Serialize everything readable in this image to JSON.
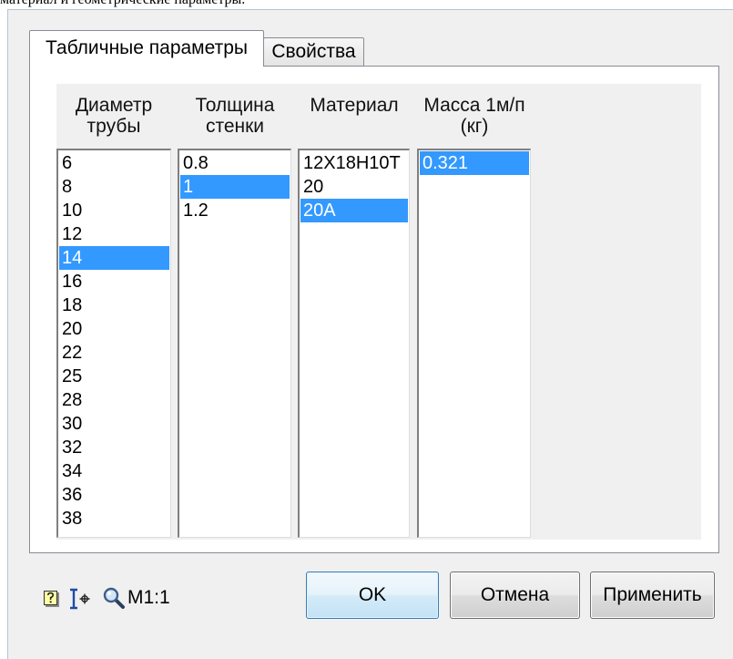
{
  "caption": "материал и геометрические параметры.",
  "tabs": [
    {
      "label": "Табличные параметры",
      "selected": true
    },
    {
      "label": "Свойства",
      "selected": false
    }
  ],
  "columns": [
    {
      "header": [
        "Диаметр",
        "трубы"
      ],
      "items": [
        "6",
        "8",
        "10",
        "12",
        "14",
        "16",
        "18",
        "20",
        "22",
        "25",
        "28",
        "30",
        "32",
        "34",
        "36",
        "38"
      ],
      "selected_index": 4
    },
    {
      "header": [
        "Толщина",
        "стенки"
      ],
      "items": [
        "0.8",
        "1",
        "1.2"
      ],
      "selected_index": 1
    },
    {
      "header": [
        "Материал"
      ],
      "items": [
        "12Х18Н10Т",
        "20",
        "20А"
      ],
      "selected_index": 2
    },
    {
      "header": [
        "Масса 1м/п",
        "(кг)"
      ],
      "items": [
        "0.321"
      ],
      "selected_index": 0
    }
  ],
  "footer": {
    "icons": [
      "help-icon",
      "ibeam-crosshair-icon",
      "magnifier-icon"
    ],
    "scale_label": "M1:1",
    "buttons": {
      "ok": "OK",
      "cancel": "Отмена",
      "apply": "Применить"
    }
  },
  "colors": {
    "selection": "#3399ff",
    "selection_text": "#ffffff",
    "dialog_bg": "#f0f0f0"
  }
}
